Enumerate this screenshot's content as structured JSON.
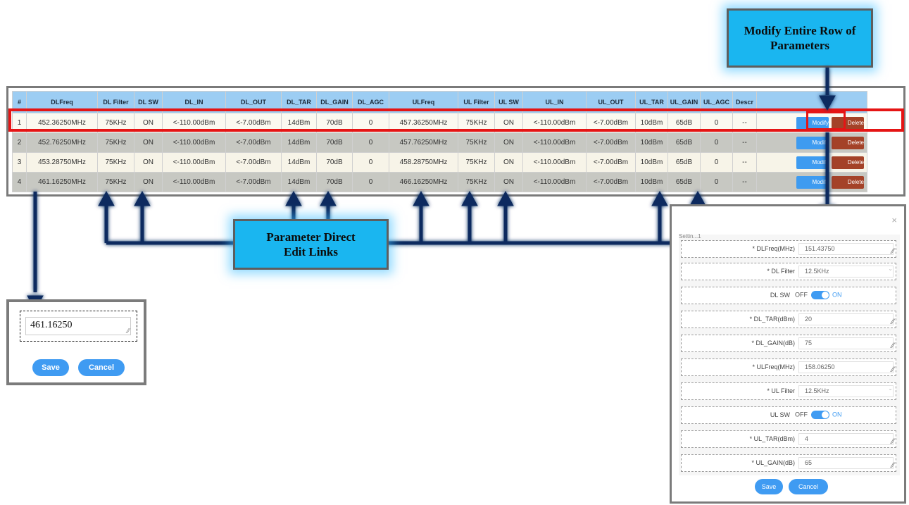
{
  "callouts": {
    "modify_row": "Modify Entire Row of Parameters",
    "direct_edit": "Parameter Direct Edit Links"
  },
  "table": {
    "headers": [
      "#",
      "DLFreq",
      "DL Filter",
      "DL SW",
      "DL_IN",
      "DL_OUT",
      "DL_TAR",
      "DL_GAIN",
      "DL_AGC",
      "ULFreq",
      "UL Filter",
      "UL SW",
      "UL_IN",
      "UL_OUT",
      "UL_TAR",
      "UL_GAIN",
      "UL_AGC",
      "Descr",
      ""
    ],
    "rows": [
      {
        "idx": "1",
        "dlfreq": "452.36250MHz",
        "dlfilter": "75KHz",
        "dlsw": "ON",
        "dlin": "<-110.00dBm",
        "dlout": "<-7.00dBm",
        "dltar": "14dBm",
        "dlgain": "70dB",
        "dlagc": "0",
        "ulfreq": "457.36250MHz",
        "ulfilter": "75KHz",
        "ulsw": "ON",
        "ulin": "<-110.00dBm",
        "ulout": "<-7.00dBm",
        "ultar": "10dBm",
        "ulgain": "65dB",
        "ulagc": "0",
        "descr": "--"
      },
      {
        "idx": "2",
        "dlfreq": "452.76250MHz",
        "dlfilter": "75KHz",
        "dlsw": "ON",
        "dlin": "<-110.00dBm",
        "dlout": "<-7.00dBm",
        "dltar": "14dBm",
        "dlgain": "70dB",
        "dlagc": "0",
        "ulfreq": "457.76250MHz",
        "ulfilter": "75KHz",
        "ulsw": "ON",
        "ulin": "<-110.00dBm",
        "ulout": "<-7.00dBm",
        "ultar": "10dBm",
        "ulgain": "65dB",
        "ulagc": "0",
        "descr": "--"
      },
      {
        "idx": "3",
        "dlfreq": "453.28750MHz",
        "dlfilter": "75KHz",
        "dlsw": "ON",
        "dlin": "<-110.00dBm",
        "dlout": "<-7.00dBm",
        "dltar": "14dBm",
        "dlgain": "70dB",
        "dlagc": "0",
        "ulfreq": "458.28750MHz",
        "ulfilter": "75KHz",
        "ulsw": "ON",
        "ulin": "<-110.00dBm",
        "ulout": "<-7.00dBm",
        "ultar": "10dBm",
        "ulgain": "65dB",
        "ulagc": "0",
        "descr": "--"
      },
      {
        "idx": "4",
        "dlfreq": "461.16250MHz",
        "dlfilter": "75KHz",
        "dlsw": "ON",
        "dlin": "<-110.00dBm",
        "dlout": "<-7.00dBm",
        "dltar": "14dBm",
        "dlgain": "70dB",
        "dlagc": "0",
        "ulfreq": "466.16250MHz",
        "ulfilter": "75KHz",
        "ulsw": "ON",
        "ulin": "<-110.00dBm",
        "ulout": "<-7.00dBm",
        "ultar": "10dBm",
        "ulgain": "65dB",
        "ulagc": "0",
        "descr": "--"
      }
    ],
    "modify_label": "Modify",
    "delete_label": "Delete"
  },
  "edit_popup": {
    "value": "461.16250",
    "save_label": "Save",
    "cancel_label": "Cancel"
  },
  "dialog": {
    "close": "×",
    "settings_tab": "Settin...1",
    "fields": [
      {
        "label": "* DLFreq(MHz)",
        "value": "151.43750",
        "kind": "text"
      },
      {
        "label": "* DL Filter",
        "value": "12.5KHz",
        "kind": "select"
      },
      {
        "label": "DL SW",
        "off": "OFF",
        "on": "ON",
        "kind": "switch"
      },
      {
        "label": "* DL_TAR(dBm)",
        "value": "20",
        "kind": "text"
      },
      {
        "label": "* DL_GAIN(dB)",
        "value": "75",
        "kind": "text"
      },
      {
        "label": "* ULFreq(MHz)",
        "value": "158.06250",
        "kind": "text"
      },
      {
        "label": "* UL Filter",
        "value": "12.5KHz",
        "kind": "select"
      },
      {
        "label": "UL SW",
        "off": "OFF",
        "on": "ON",
        "kind": "switch"
      },
      {
        "label": "* UL_TAR(dBm)",
        "value": "4",
        "kind": "text"
      },
      {
        "label": "* UL_GAIN(dB)",
        "value": "65",
        "kind": "text"
      }
    ],
    "save_label": "Save",
    "cancel_label": "Cancel"
  },
  "colors": {
    "callout": "#1ab6f0",
    "header": "#9ccdf3",
    "link": "#2f4cd6",
    "highlight": "#e51515",
    "modify_button": "#3e9bf0",
    "delete_button": "#a44228"
  },
  "icons": {
    "arrow": "navy-down-up-arrow-icon",
    "resize": "textarea-resize-icon",
    "chevron": "chevron-down-icon",
    "close": "close-icon"
  }
}
